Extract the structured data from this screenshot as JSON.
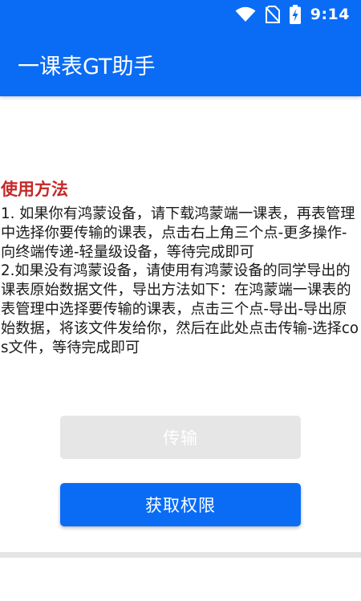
{
  "status_bar": {
    "time": "9:14",
    "icons": [
      "wifi-icon",
      "no-sim-icon",
      "battery-charging-icon"
    ]
  },
  "app_bar": {
    "title": "一课表GT助手",
    "color": "#0a6cf5"
  },
  "usage": {
    "title": "使用方法",
    "title_color": "#c62828",
    "body": "1. 如果你有鸿蒙设备，请下载鸿蒙端一课表，再表管理中选择你要传输的课表，点击右上角三个点-更多操作-向终端传递-轻量级设备，等待完成即可\n2.如果没有鸿蒙设备，请使用有鸿蒙设备的同学导出的课表原始数据文件，导出方法如下：在鸿蒙端一课表的表管理中选择要传输的课表，点击三个点-导出-导出原始数据，将该文件发给你，然后在此处点击传输-选择cos文件，等待完成即可"
  },
  "buttons": {
    "transfer_label": "传输",
    "transfer_state": "disabled",
    "permission_label": "获取权限"
  }
}
